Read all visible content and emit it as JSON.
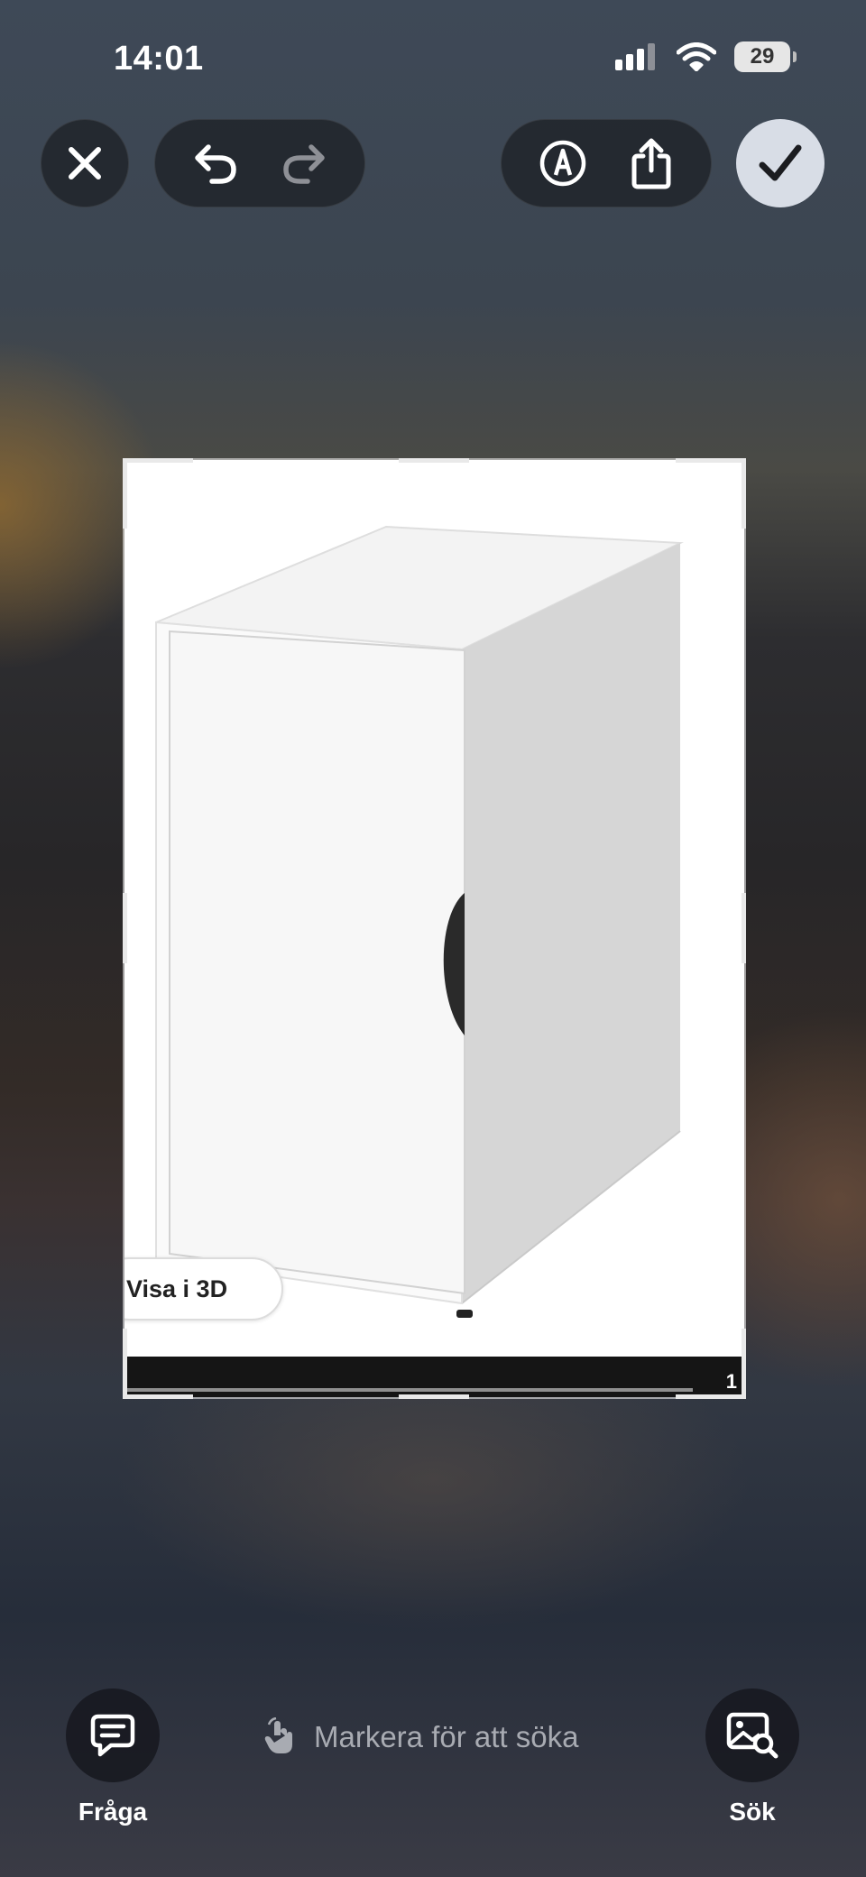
{
  "status_bar": {
    "time": "14:01",
    "battery_level": "29",
    "signal_icon": "cellular-signal-icon",
    "wifi_icon": "wifi-icon"
  },
  "toolbar": {
    "close_icon": "close-icon",
    "undo_icon": "undo-icon",
    "redo_icon": "redo-icon",
    "markup_icon": "markup-pen-icon",
    "share_icon": "share-icon",
    "done_icon": "checkmark-icon",
    "redo_enabled": false
  },
  "image": {
    "subject": "white-cabinet-photo",
    "visa_3d_label": "Visa i 3D",
    "page_number": "1",
    "progress": 1.0
  },
  "bottom": {
    "ask_label": "Fråga",
    "ask_icon": "speech-bubble-icon",
    "hint_text": "Markera för att söka",
    "hint_icon": "tap-hand-icon",
    "search_label": "Sök",
    "search_icon": "image-search-icon"
  },
  "colors": {
    "done_button": "#d8dde6",
    "photo_background": "#ffffff",
    "photo_bar": "#151515",
    "hint_text": "#a8abb2"
  }
}
